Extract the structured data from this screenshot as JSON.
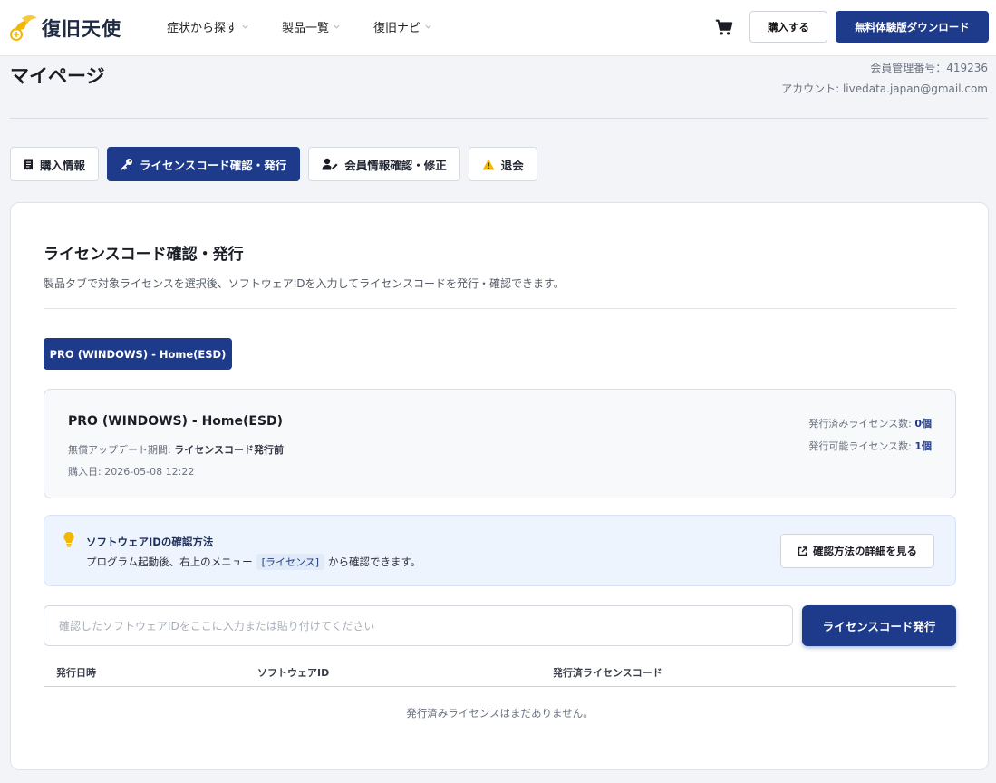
{
  "header": {
    "logo_text": "復旧天使",
    "nav": [
      {
        "label": "症状から探す"
      },
      {
        "label": "製品一覧"
      },
      {
        "label": "復旧ナビ"
      }
    ],
    "buy_label": "購入する",
    "download_label": "無料体験版ダウンロード"
  },
  "page": {
    "title": "マイページ",
    "member_no": "会員管理番号：419236",
    "account": "アカウント: livedata.japan@gmail.com"
  },
  "tabs": [
    {
      "label": "購入情報",
      "icon": "receipt-icon"
    },
    {
      "label": "ライセンスコード確認・発行",
      "icon": "key-icon",
      "active": true
    },
    {
      "label": "会員情報確認・修正",
      "icon": "user-edit-icon"
    },
    {
      "label": "退会",
      "icon": "warning-icon"
    }
  ],
  "license": {
    "title": "ライセンスコード確認・発行",
    "description": "製品タブで対象ライセンスを選択後、ソフトウェアIDを入力してライセンスコードを発行・確認できます。",
    "product_tab_label": "PRO (WINDOWS) - Home(ESD)",
    "product": {
      "name": "PRO (WINDOWS) - Home(ESD)",
      "update_label": "無償アップデート期間: ",
      "update_value": "ライセンスコード発行前",
      "purchase_date": "購入日: 2026-05-08 12:22",
      "issued_label": "発行済みライセンス数: ",
      "issued_value": "0個",
      "available_label": "発行可能ライセンス数: ",
      "available_value": "1個"
    },
    "info": {
      "title": "ソフトウェアIDの確認方法",
      "text_before": "プログラム起動後、右上のメニュー",
      "tag": "[ライセンス]",
      "text_after": "から確認できます。",
      "button_label": "確認方法の詳細を見る"
    },
    "input_placeholder": "確認したソフトウェアIDをここに入力または貼り付けてください",
    "input_value": "",
    "issue_button_label": "ライセンスコード発行",
    "table": {
      "columns": [
        "発行日時",
        "ソフトウェアID",
        "発行済ライセンスコード"
      ],
      "empty_message": "発行済みライセンスはまだありません。"
    }
  },
  "colors": {
    "primary": "#1e3a8a",
    "accent_gold": "#f2b705"
  }
}
